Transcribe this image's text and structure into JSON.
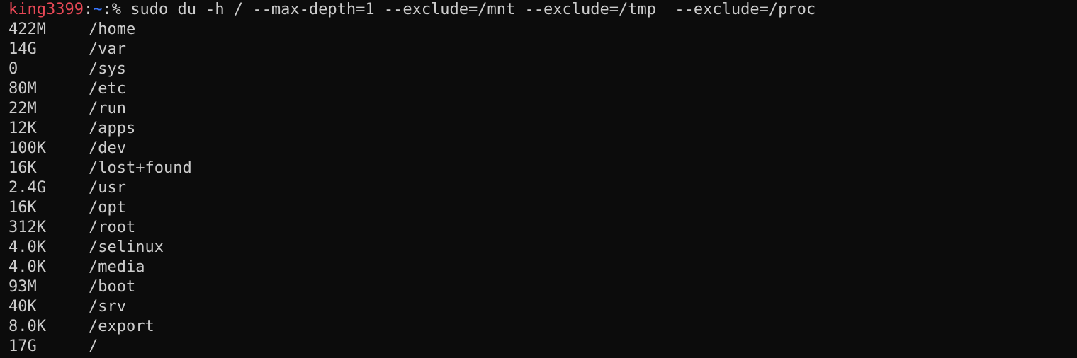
{
  "colors": {
    "background": "#0c0c0c",
    "foreground": "#cccccc",
    "user": "#e74856",
    "directory": "#3b78ff"
  },
  "prompt": {
    "user": "king3399",
    "separator": ":",
    "directory": "~",
    "symbol": ":% ",
    "command": "sudo du -h / --max-depth=1 --exclude=/mnt --exclude=/tmp  --exclude=/proc"
  },
  "output": [
    {
      "size": "422M",
      "path": "/home"
    },
    {
      "size": "14G",
      "path": "/var"
    },
    {
      "size": "0",
      "path": "/sys"
    },
    {
      "size": "80M",
      "path": "/etc"
    },
    {
      "size": "22M",
      "path": "/run"
    },
    {
      "size": "12K",
      "path": "/apps"
    },
    {
      "size": "100K",
      "path": "/dev"
    },
    {
      "size": "16K",
      "path": "/lost+found"
    },
    {
      "size": "2.4G",
      "path": "/usr"
    },
    {
      "size": "16K",
      "path": "/opt"
    },
    {
      "size": "312K",
      "path": "/root"
    },
    {
      "size": "4.0K",
      "path": "/selinux"
    },
    {
      "size": "4.0K",
      "path": "/media"
    },
    {
      "size": "93M",
      "path": "/boot"
    },
    {
      "size": "40K",
      "path": "/srv"
    },
    {
      "size": "8.0K",
      "path": "/export"
    },
    {
      "size": "17G",
      "path": "/"
    }
  ]
}
